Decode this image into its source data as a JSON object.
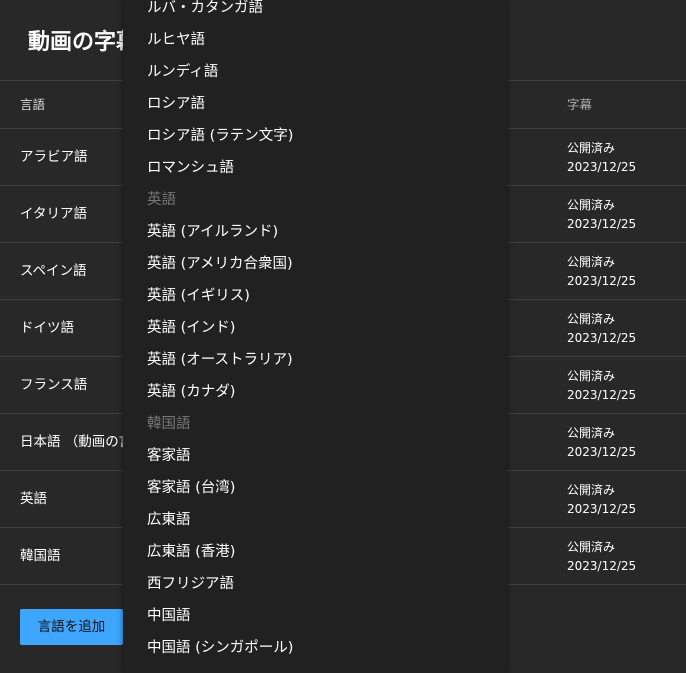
{
  "page": {
    "title": "動画の字幕"
  },
  "table": {
    "headers": {
      "language": "言語",
      "subtitles": "字幕"
    },
    "rows": [
      {
        "language": "アラビア語",
        "status": "公開済み",
        "date": "2023/12/25"
      },
      {
        "language": "イタリア語",
        "status": "公開済み",
        "date": "2023/12/25"
      },
      {
        "language": "スペイン語",
        "status": "公開済み",
        "date": "2023/12/25"
      },
      {
        "language": "ドイツ語",
        "status": "公開済み",
        "date": "2023/12/25"
      },
      {
        "language": "フランス語",
        "status": "公開済み",
        "date": "2023/12/25"
      },
      {
        "language": "日本語 （動画の言語）",
        "status": "公開済み",
        "date": "2023/12/25"
      },
      {
        "language": "英語",
        "status": "公開済み",
        "date": "2023/12/25"
      },
      {
        "language": "韓国語",
        "status": "公開済み",
        "date": "2023/12/25"
      }
    ]
  },
  "add_language_button": "言語を追加",
  "dropdown": {
    "items": [
      {
        "label": "ルバ・カタンガ語",
        "disabled": false
      },
      {
        "label": "ルヒヤ語",
        "disabled": false
      },
      {
        "label": "ルンディ語",
        "disabled": false
      },
      {
        "label": "ロシア語",
        "disabled": false
      },
      {
        "label": "ロシア語 (ラテン文字)",
        "disabled": false
      },
      {
        "label": "ロマンシュ語",
        "disabled": false
      },
      {
        "label": "英語",
        "disabled": true
      },
      {
        "label": "英語 (アイルランド)",
        "disabled": false
      },
      {
        "label": "英語 (アメリカ合衆国)",
        "disabled": false
      },
      {
        "label": "英語 (イギリス)",
        "disabled": false
      },
      {
        "label": "英語 (インド)",
        "disabled": false
      },
      {
        "label": "英語 (オーストラリア)",
        "disabled": false
      },
      {
        "label": "英語 (カナダ)",
        "disabled": false
      },
      {
        "label": "韓国語",
        "disabled": true
      },
      {
        "label": "客家語",
        "disabled": false
      },
      {
        "label": "客家語 (台湾)",
        "disabled": false
      },
      {
        "label": "広東語",
        "disabled": false
      },
      {
        "label": "広東語 (香港)",
        "disabled": false
      },
      {
        "label": "西フリジア語",
        "disabled": false
      },
      {
        "label": "中国語",
        "disabled": false
      },
      {
        "label": "中国語 (シンガポール)",
        "disabled": false
      }
    ]
  }
}
